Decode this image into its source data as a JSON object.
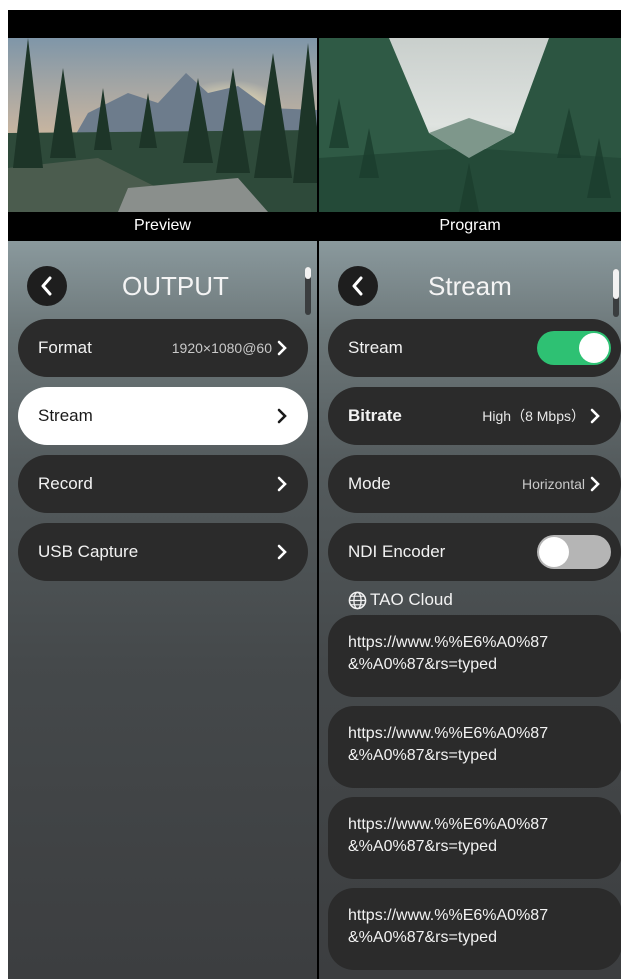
{
  "monitors": {
    "preview_label": "Preview",
    "program_label": "Program"
  },
  "output_panel": {
    "title": "OUTPUT",
    "back_icon": "chevron-left-icon",
    "items": [
      {
        "label": "Format",
        "value": "1920×1080@60"
      },
      {
        "label": "Stream",
        "value": ""
      },
      {
        "label": "Record",
        "value": ""
      },
      {
        "label": "USB Capture",
        "value": ""
      }
    ],
    "selected": "Stream"
  },
  "stream_panel": {
    "title": "Stream",
    "back_icon": "chevron-left-icon",
    "stream_toggle": {
      "label": "Stream",
      "on": true
    },
    "bitrate": {
      "label": "Bitrate",
      "value": "High（8 Mbps）"
    },
    "mode": {
      "label": "Mode",
      "value": "Horizontal"
    },
    "ndi_toggle": {
      "label": "NDI Encoder",
      "on": false
    },
    "cloud_section": {
      "label": "TAO Cloud",
      "icon": "globe-icon"
    },
    "urls": [
      {
        "line1": "https://www.%%E6%A0%87",
        "line2": "&%A0%87&rs=typed"
      },
      {
        "line1": "https://www.%%E6%A0%87",
        "line2": "&%A0%87&rs=typed"
      },
      {
        "line1": "https://www.%%E6%A0%87",
        "line2": "&%A0%87&rs=typed"
      },
      {
        "line1": "https://www.%%E6%A0%87",
        "line2": "&%A0%87&rs=typed"
      }
    ]
  },
  "colors": {
    "toggle_on": "#2ec173",
    "toggle_off": "#b5b5b5",
    "row_bg": "#2b2b2b",
    "selected_bg": "#ffffff"
  }
}
